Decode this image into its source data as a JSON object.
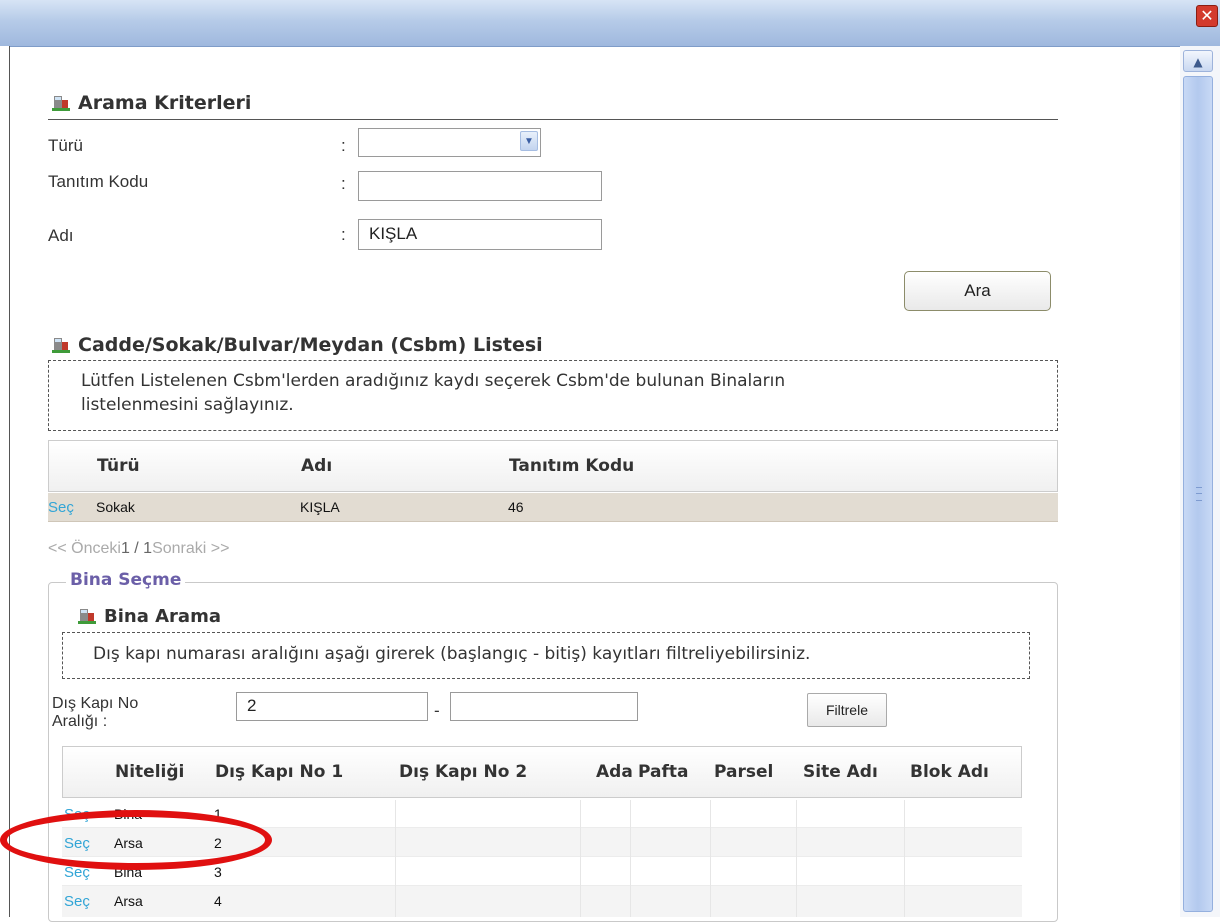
{
  "window": {
    "close_glyph": "✕"
  },
  "criteria": {
    "title": "Arama Kriterleri",
    "type_label": "Türü",
    "code_label": "Tanıtım Kodu",
    "name_label": "Adı",
    "colon": ":",
    "type_value": "",
    "code_value": "",
    "name_value": "KIŞLA",
    "search_button": "Ara"
  },
  "csbm": {
    "title": "Cadde/Sokak/Bulvar/Meydan (Csbm) Listesi",
    "note_line1": "Lütfen Listelenen Csbm'lerden aradığınız kaydı seçerek Csbm'de bulunan Binaların",
    "note_line2": "listelenmesini sağlayınız.",
    "columns": {
      "type": "Türü",
      "name": "Adı",
      "code": "Tanıtım Kodu"
    },
    "rows": [
      {
        "select": "Seç",
        "type": "Sokak",
        "name": "KIŞLA",
        "code": "46"
      }
    ],
    "pager": {
      "prev": "<< Önceki",
      "current": "1 / 1",
      "next": "Sonraki >>"
    }
  },
  "building": {
    "legend": "Bina Seçme",
    "search_title": "Bina Arama",
    "note": "Dış kapı numarası aralığını aşağı girerek (başlangıç - bitiş) kayıtları filtreliyebilirsiniz.",
    "range_label_line1": "Dış Kapı No",
    "range_label_line2": "Aralığı :",
    "range_from": "2",
    "range_dash": "-",
    "range_to": "",
    "filter_button": "Filtrele",
    "columns": {
      "nature": "Niteliği",
      "door1": "Dış Kapı No 1",
      "door2": "Dış Kapı No 2",
      "ada": "Ada",
      "pafta": "Pafta",
      "parsel": "Parsel",
      "site": "Site Adı",
      "block": "Blok Adı"
    },
    "rows": [
      {
        "select": "Seç",
        "nature": "Bina",
        "door1": "1"
      },
      {
        "select": "Seç",
        "nature": "Arsa",
        "door1": "2"
      },
      {
        "select": "Seç",
        "nature": "Bina",
        "door1": "3"
      },
      {
        "select": "Seç",
        "nature": "Arsa",
        "door1": "4"
      }
    ]
  },
  "colors": {
    "link": "#32a5d6",
    "legend": "#6b5fa8",
    "highlight": "#e01010",
    "selected_row": "#e2dcd2"
  },
  "icons": [
    "building-icon",
    "close-icon",
    "chevron-down-icon",
    "chevron-up-icon"
  ]
}
